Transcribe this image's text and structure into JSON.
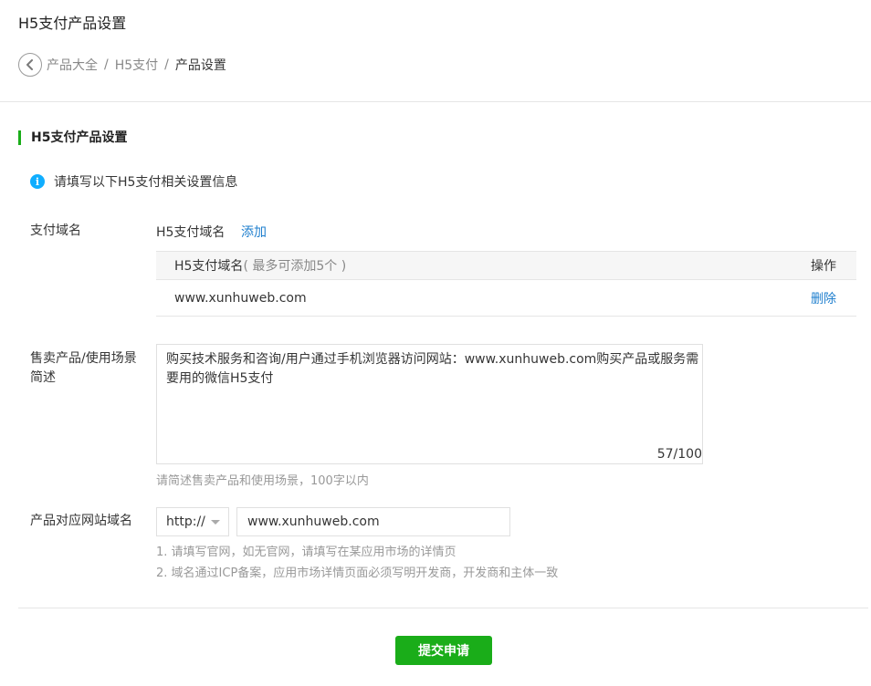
{
  "page": {
    "title": "H5支付产品设置"
  },
  "breadcrumb": {
    "items": [
      "产品大全",
      "H5支付",
      "产品设置"
    ],
    "separator": "/"
  },
  "section": {
    "title": "H5支付产品设置"
  },
  "notice": {
    "icon": "info-icon",
    "text": "请填写以下H5支付相关设置信息"
  },
  "pay_domain": {
    "label": "支付域名",
    "title": "H5支付域名",
    "add_label": "添加",
    "table": {
      "col_domain": "H5支付域名",
      "col_domain_hint": "( 最多可添加5个 )",
      "col_action": "操作",
      "rows": [
        {
          "domain": "www.xunhuweb.com",
          "action": "删除"
        }
      ]
    }
  },
  "description": {
    "label_line1": "售卖产品/使用场景",
    "label_line2": "简述",
    "value": "购买技术服务和咨询/用户通过手机浏览器访问网站：www.xunhuweb.com购买产品或服务需要用的微信H5支付",
    "counter": "57/100",
    "hint": "请简述售卖产品和使用场景，100字以内"
  },
  "website": {
    "label": "产品对应网站域名",
    "protocol": "http://",
    "url": "www.xunhuweb.com",
    "hint_1": "1. 请填写官网，如无官网，请填写在某应用市场的详情页",
    "hint_2": "2. 域名通过ICP备案，应用市场详情页面必须写明开发商，开发商和主体一致"
  },
  "submit": {
    "label": "提交申请"
  },
  "colors": {
    "accent": "#1aad19",
    "link": "#1f7fce",
    "info": "#10aeff"
  }
}
